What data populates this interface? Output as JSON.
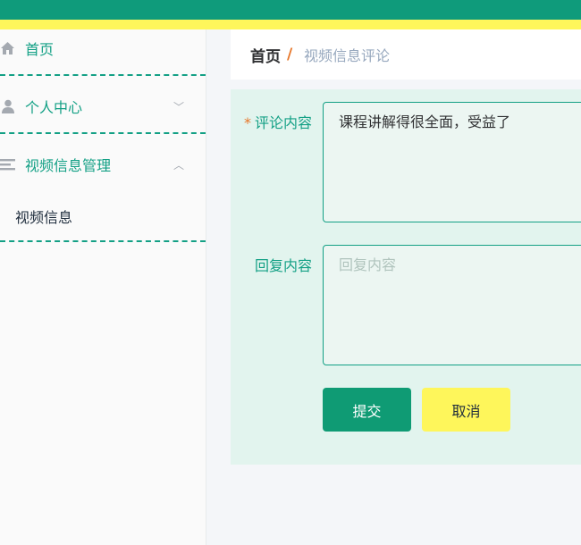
{
  "sidebar": {
    "items": [
      {
        "label": "首页",
        "icon": "home-icon"
      },
      {
        "label": "个人中心",
        "icon": "user-icon",
        "chevron": "﹀"
      },
      {
        "label": "视频信息管理",
        "icon": "list-icon",
        "chevron": "︿",
        "children": [
          {
            "label": "视频信息"
          }
        ]
      }
    ]
  },
  "breadcrumb": {
    "home": "首页",
    "separator": "/",
    "current": "视频信息评论"
  },
  "form": {
    "comment": {
      "required_mark": "*",
      "label": "评论内容",
      "value": "课程讲解得很全面，受益了"
    },
    "reply": {
      "label": "回复内容",
      "placeholder": "回复内容",
      "value": ""
    },
    "submit_label": "提交",
    "cancel_label": "取消"
  },
  "colors": {
    "accent": "#0f9b7b",
    "highlight": "#fef65b",
    "breadcrumb_separator": "#e7772a",
    "form_background": "#e2f4ee"
  }
}
